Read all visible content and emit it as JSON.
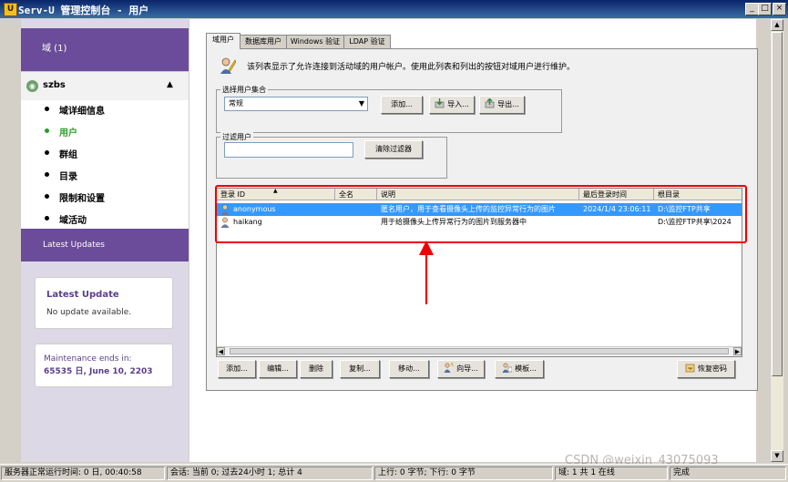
{
  "window": {
    "title": "Serv-U 管理控制台 - 用户",
    "min": "_",
    "max": "□",
    "close": "×"
  },
  "sidebar": {
    "domain_label": "域 (1)",
    "server_name": "szbs",
    "items": [
      {
        "label": "域详细信息"
      },
      {
        "label": "用户"
      },
      {
        "label": "群组"
      },
      {
        "label": "目录"
      },
      {
        "label": "限制和设置"
      },
      {
        "label": "域活动"
      }
    ],
    "latest_updates_label": "Latest Updates",
    "latest_update_card": {
      "title": "Latest Update",
      "text": "No update available."
    },
    "maintenance_card": {
      "line1": "Maintenance ends in:",
      "line2": "65535 日, June 10, 2203"
    }
  },
  "tabs": [
    {
      "label": "域用户"
    },
    {
      "label": "数据库用户"
    },
    {
      "label": "Windows 验证"
    },
    {
      "label": "LDAP 验证"
    }
  ],
  "info_text": "该列表显示了允许连接到活动域的用户帐户。使用此列表和列出的按钮对域用户进行维护。",
  "user_collection": {
    "legend": "选择用户集合",
    "selected": "常规",
    "add_label": "添加...",
    "import_label": "导入...",
    "export_label": "导出..."
  },
  "filter": {
    "legend": "过滤用户",
    "value": "",
    "clear_label": "清除过滤器"
  },
  "table": {
    "columns": [
      "登录 ID",
      "全名",
      "说明",
      "最后登录时间",
      "根目录"
    ],
    "rows": [
      {
        "login": "anonymous",
        "fullname": "",
        "desc": "匿名用户，用于查看摄像头上传的监控异常行为的图片",
        "last": "2024/1/4 23:06:11",
        "root": "D:\\监控FTP共享"
      },
      {
        "login": "haikang",
        "fullname": "",
        "desc": "用于给摄像头上传异常行为的图片到服务器中",
        "last": "",
        "root": "D:\\监控FTP共享\\2024"
      }
    ]
  },
  "actions": {
    "add": "添加...",
    "edit": "编辑...",
    "delete": "删除",
    "copy": "复制...",
    "move": "移动...",
    "wizard": "向导...",
    "template": "模板...",
    "recover": "恢复密码"
  },
  "statusbar": {
    "uptime": "服务器正常运行时间: 0 日, 00:40:58",
    "sessions": "会话: 当前 0; 过去24小时 1; 总计 4",
    "transfer": "上行: 0 字节; 下行: 0 字节",
    "domains": "域: 1 共 1 在线",
    "done": "完成"
  },
  "watermark": "CSDN @weixin_43075093",
  "colors": {
    "purple": "#6b4c9a",
    "active_green": "#2a9d2a",
    "selection": "#3399ff",
    "highlight_red": "#e00000"
  }
}
